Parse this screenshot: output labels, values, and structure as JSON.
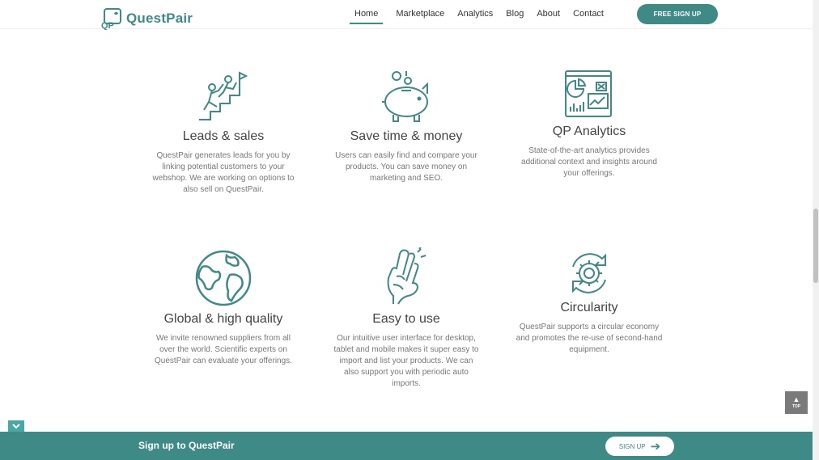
{
  "header": {
    "logo_text": "QuestPair",
    "logo_mark": "QP",
    "nav": [
      "Home",
      "Marketplace",
      "Analytics",
      "Blog",
      "About",
      "Contact"
    ],
    "active_nav": "Home",
    "signup_label": "FREE SIGN UP"
  },
  "features": [
    {
      "icon": "climbing-icon",
      "title": "Leads & sales",
      "text": "QuestPair generates leads for you by linking potential customers to your webshop. We are working on options to also sell on QuestPair."
    },
    {
      "icon": "piggy-bank-icon",
      "title": "Save time & money",
      "text": "Users can easily find and compare your products. You can save money on marketing and SEO."
    },
    {
      "icon": "analytics-dashboard-icon",
      "title": "QP Analytics",
      "text": "State-of-the-art analytics provides additional context and insights around your offerings."
    },
    {
      "icon": "globe-icon",
      "title": "Global & high quality",
      "text": "We invite renowned suppliers from all over the world. Scientific experts on QuestPair can evaluate your offerings."
    },
    {
      "icon": "crossed-fingers-icon",
      "title": "Easy to use",
      "text": "Our intuitive user interface for desktop, tablet and mobile makes it super easy to import and list your products. We can also support you with periodic auto imports."
    },
    {
      "icon": "circular-gear-icon",
      "title": "Circularity",
      "text": "QuestPair supports a circular economy and promotes the re-use of second-hand equipment."
    }
  ],
  "top_button": {
    "label": "TOP"
  },
  "bottom_bar": {
    "title": "Sign up to QuestPair",
    "button_label": "SIGN UP"
  },
  "colors": {
    "accent": "#3d8a86",
    "bar": "#3d8a86",
    "tab": "#4aa8a4"
  }
}
